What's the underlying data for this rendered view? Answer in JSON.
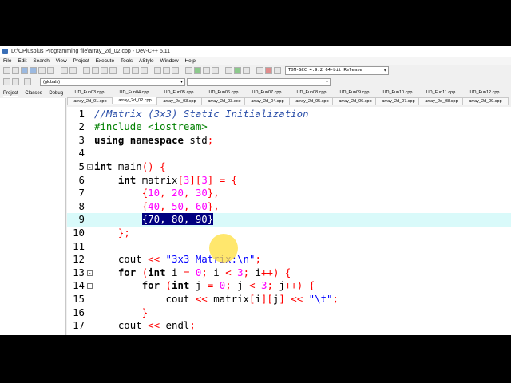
{
  "window": {
    "title": "D:\\CPlusplus Programming file\\array_2d_02.cpp - Dev-C++ 5.11"
  },
  "menu": [
    "File",
    "Edit",
    "Search",
    "View",
    "Project",
    "Execute",
    "Tools",
    "AStyle",
    "Window",
    "Help"
  ],
  "toolbar": {
    "compiler": "TDM-GCC 4.9.2 64-bit Release",
    "scope": "(globals)"
  },
  "panel_tabs": [
    "Project",
    "Classes",
    "Debug"
  ],
  "file_tabs_top": [
    "UD_Fun03.cpp",
    "UD_Fun04.cpp",
    "UD_Fun05.cpp",
    "UD_Fun06.cpp",
    "UD_Fun07.cpp",
    "UD_Fun08.cpp",
    "UD_Fun09.cpp",
    "UD_Fun10.cpp",
    "UD_Fun11.cpp",
    "UD_Fun12.cpp"
  ],
  "file_tabs_bottom": [
    "array_2d_01.cpp",
    "array_2d_02.cpp",
    "array_2d_03.cpp",
    "array_2d_03.exe",
    "array_2d_04.cpp",
    "array_2d_05.cpp",
    "array_2d_06.cpp",
    "array_2d_07.cpp",
    "array_2d_08.cpp",
    "array_2d_09.cpp"
  ],
  "active_file_tab": "array_2d_02.cpp",
  "editor": {
    "current_line": 9,
    "lines": [
      {
        "n": "1",
        "text": "//Matrix (3x3) Static Initialization"
      },
      {
        "n": "2",
        "text": "#include <iostream>"
      },
      {
        "n": "3",
        "text": "using namespace std;"
      },
      {
        "n": "4",
        "text": ""
      },
      {
        "n": "5",
        "text": "int main() {"
      },
      {
        "n": "6",
        "text": "    int matrix[3][3] = {"
      },
      {
        "n": "7",
        "text": "        {10, 20, 30},"
      },
      {
        "n": "8",
        "text": "        {40, 50, 60},"
      },
      {
        "n": "9",
        "text": "        {70, 80, 90}"
      },
      {
        "n": "10",
        "text": "    };"
      },
      {
        "n": "11",
        "text": ""
      },
      {
        "n": "12",
        "text": "    cout << \"3x3 Matrix:\\n\";"
      },
      {
        "n": "13",
        "text": "    for (int i = 0; i < 3; i++) {"
      },
      {
        "n": "14",
        "text": "        for (int j = 0; j < 3; j++) {"
      },
      {
        "n": "15",
        "text": "            cout << matrix[i][j] << \"\\t\";"
      },
      {
        "n": "16",
        "text": "        }"
      },
      {
        "n": "17",
        "text": "    cout << endl;"
      }
    ]
  },
  "colors": {
    "comment": "#2a4ea8",
    "preprocessor": "#008000",
    "number": "#ff00ff",
    "string": "#0000ff",
    "symbol": "#ff0000",
    "current_line": "#d9fafa",
    "selection": "#000080"
  }
}
